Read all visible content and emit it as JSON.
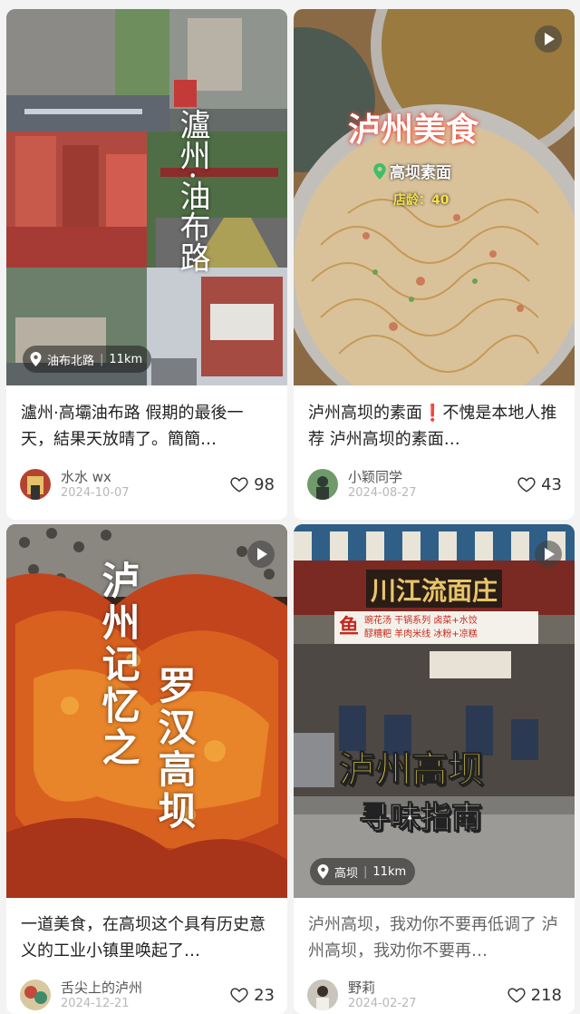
{
  "cards": [
    {
      "title": "瀘州·高壩油布路 假期的最後一天，結果天放晴了。簡簡…",
      "user": "水水 wx",
      "date": "2024-10-07",
      "likes": "98",
      "image_text": "瀘州·油布路",
      "location": "油布北路",
      "distance": "11km"
    },
    {
      "title": "泸州高坝的素面❗不愧是本地人推荐 泸州高坝的素面…",
      "user": "小颖同学",
      "date": "2024-08-27",
      "likes": "43",
      "overlay_title": "泸州美食",
      "overlay_place": "高坝素面",
      "overlay_age": "店龄：40"
    },
    {
      "title": "一道美食，在高坝这个具有历史意义的工业小镇里唤起了…",
      "user": "舌尖上的泸州",
      "date": "2024-12-21",
      "likes": "23",
      "overlay_left": "泸州记忆之",
      "overlay_right": "罗汉高坝"
    },
    {
      "title": "泸州高坝，我劝你不要再低调了 泸州高坝，我劝你不要再…",
      "user": "野莉",
      "date": "2024-02-27",
      "likes": "218",
      "shop_name": "川江流面庄",
      "shop_board_1": "鱼",
      "shop_board_2": "豌花汤 干锅系列 卤菜+水饺",
      "shop_board_3": "醪糟粑 羊肉米线 冰粉+凉糕",
      "overlay_big": "泸州高坝",
      "overlay_small": "寻味指南",
      "location": "高坝",
      "distance": "11km"
    }
  ],
  "colors": {
    "accent_yellow": "#f6e04a",
    "like_icon": "#333333"
  }
}
